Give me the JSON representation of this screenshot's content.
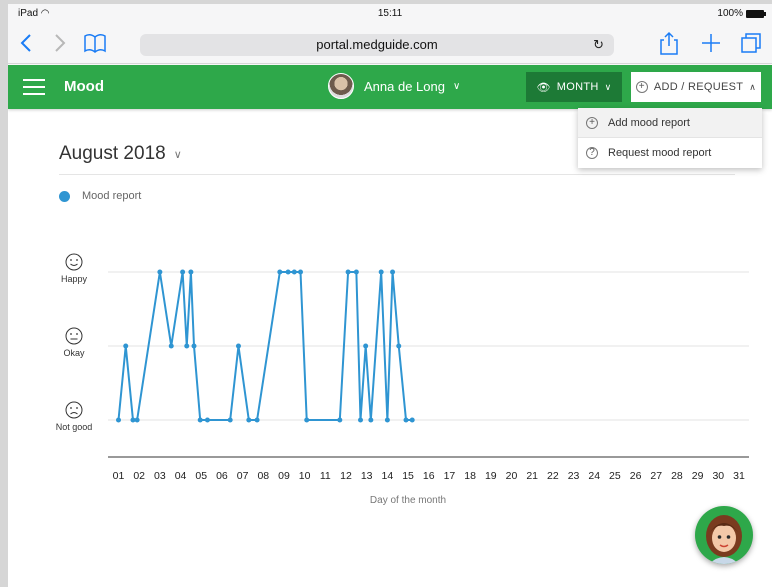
{
  "status_bar": {
    "device": "iPad",
    "time": "15:11",
    "battery": "100%"
  },
  "browser": {
    "url": "portal.medguide.com"
  },
  "app": {
    "title": "Mood",
    "user_name": "Anna de Long",
    "view_button": "MONTH",
    "add_button": "ADD / REQUEST"
  },
  "dropdown": {
    "items": [
      {
        "label": "Add mood report"
      },
      {
        "label": "Request mood report"
      }
    ]
  },
  "period": {
    "label": "August 2018"
  },
  "legend": {
    "label": "Mood report"
  },
  "colors": {
    "brand": "#2ea84a",
    "brand_dark": "#1d7a36",
    "series": "#2f95d2"
  },
  "chart_data": {
    "type": "line",
    "xlabel": "Day of the month",
    "ylabel": "",
    "y_categories": [
      "Not good",
      "Okay",
      "Happy"
    ],
    "xlim": [
      1,
      31
    ],
    "grid": true,
    "legend_position": "top-left",
    "x_ticks": [
      "01",
      "02",
      "03",
      "04",
      "05",
      "06",
      "07",
      "08",
      "09",
      "10",
      "11",
      "12",
      "13",
      "14",
      "15",
      "16",
      "17",
      "18",
      "19",
      "20",
      "21",
      "22",
      "23",
      "24",
      "25",
      "26",
      "27",
      "28",
      "29",
      "30",
      "31"
    ],
    "series": [
      {
        "name": "Mood report",
        "points": [
          [
            1.0,
            0
          ],
          [
            1.35,
            1
          ],
          [
            1.7,
            0
          ],
          [
            1.9,
            0
          ],
          [
            3.0,
            2
          ],
          [
            3.55,
            1
          ],
          [
            4.1,
            2
          ],
          [
            4.3,
            1
          ],
          [
            4.5,
            2
          ],
          [
            4.65,
            1
          ],
          [
            4.95,
            0
          ],
          [
            5.3,
            0
          ],
          [
            6.4,
            0
          ],
          [
            6.8,
            1
          ],
          [
            7.3,
            0
          ],
          [
            7.7,
            0
          ],
          [
            8.8,
            2
          ],
          [
            9.2,
            2
          ],
          [
            9.5,
            2
          ],
          [
            9.8,
            2
          ],
          [
            10.1,
            0
          ],
          [
            11.7,
            0
          ],
          [
            12.1,
            2
          ],
          [
            12.5,
            2
          ],
          [
            12.7,
            0
          ],
          [
            12.95,
            1
          ],
          [
            13.2,
            0
          ],
          [
            13.7,
            2
          ],
          [
            14.0,
            0
          ],
          [
            14.25,
            2
          ],
          [
            14.55,
            1
          ],
          [
            14.9,
            0
          ],
          [
            15.2,
            0
          ]
        ]
      }
    ]
  }
}
